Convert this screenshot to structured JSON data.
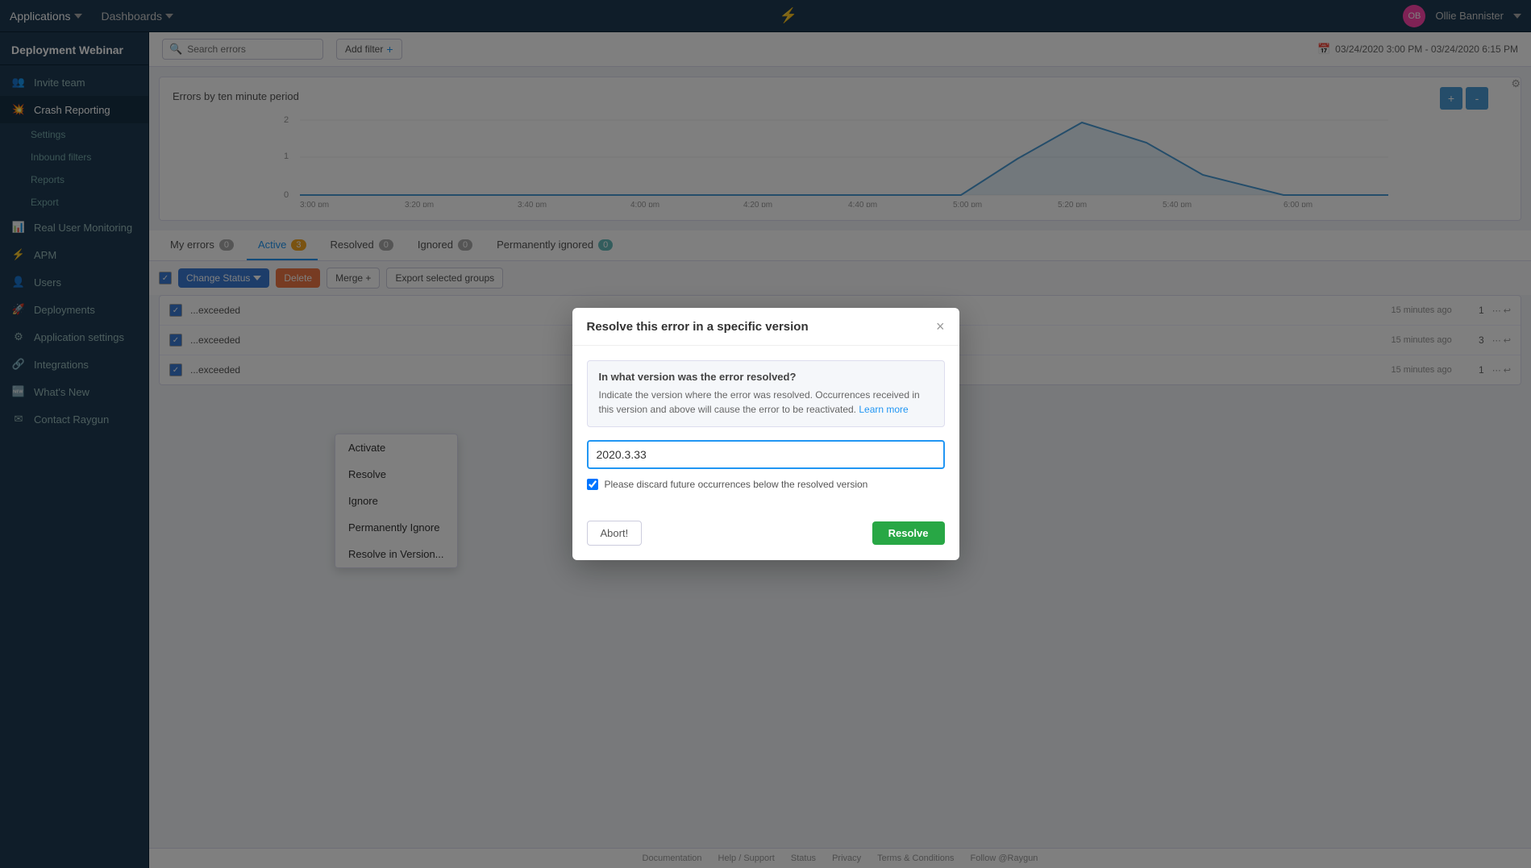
{
  "topnav": {
    "apps_label": "Applications",
    "dashboards_label": "Dashboards",
    "alert_icon": "bell",
    "user_name": "Ollie Bannister",
    "user_initials": "OB"
  },
  "sidebar": {
    "project_name": "Deployment Webinar",
    "invite_team": "Invite team",
    "sections": [
      {
        "label": "Crash Reporting",
        "icon": "crash",
        "active": true,
        "children": [
          {
            "label": "Settings"
          },
          {
            "label": "Inbound filters"
          },
          {
            "label": "Reports"
          },
          {
            "label": "Export"
          }
        ]
      },
      {
        "label": "Real User Monitoring",
        "icon": "rum"
      },
      {
        "label": "APM",
        "icon": "apm"
      },
      {
        "label": "Users",
        "icon": "users"
      },
      {
        "label": "Deployments",
        "icon": "deployments"
      },
      {
        "label": "Application settings",
        "icon": "appsettings"
      },
      {
        "label": "Integrations",
        "icon": "integrations"
      },
      {
        "label": "What's New",
        "icon": "whatsnew"
      },
      {
        "label": "Contact Raygun",
        "icon": "contact"
      }
    ]
  },
  "subheader": {
    "search_placeholder": "Search errors",
    "add_filter_label": "Add filter",
    "date_range": "03/24/2020 3:00 PM - 03/24/2020 6:15 PM"
  },
  "chart": {
    "title": "Errors by ten minute period",
    "y_labels": [
      "2",
      "1",
      "0"
    ],
    "x_labels": [
      "3:00 pm",
      "3:20 pm",
      "3:40 pm",
      "4:00 pm",
      "4:20 pm",
      "4:40 pm",
      "5:00 pm",
      "5:20 pm",
      "5:40 pm",
      "6:00 pm"
    ]
  },
  "tabs": [
    {
      "label": "My errors",
      "badge": "0",
      "badge_color": "gray",
      "active": false
    },
    {
      "label": "Active",
      "badge": "3",
      "badge_color": "orange",
      "active": true
    },
    {
      "label": "Resolved",
      "badge": "0",
      "badge_color": "gray",
      "active": false
    },
    {
      "label": "Ignored",
      "badge": "0",
      "badge_color": "gray",
      "active": false
    },
    {
      "label": "Permanently ignored",
      "badge": "0",
      "badge_color": "teal",
      "active": false
    }
  ],
  "toolbar": {
    "change_status_label": "Change Status",
    "delete_label": "Delete",
    "merge_label": "Merge +",
    "export_label": "Export selected groups"
  },
  "dropdown": {
    "items": [
      {
        "label": "Activate"
      },
      {
        "label": "Resolve"
      },
      {
        "label": "Ignore"
      },
      {
        "label": "Permanently Ignore"
      },
      {
        "label": "Resolve in Version..."
      }
    ]
  },
  "errors": [
    {
      "msg": "...exceeded",
      "time": "15 minutes ago",
      "count": "1"
    },
    {
      "msg": "...exceeded",
      "time": "15 minutes ago",
      "count": "3"
    },
    {
      "msg": "...exceeded",
      "time": "15 minutes ago",
      "count": "1"
    }
  ],
  "footer": {
    "links": [
      "Documentation",
      "Help / Support",
      "Status",
      "Privacy",
      "Terms & Conditions",
      "Follow @Raygun"
    ]
  },
  "modal": {
    "title": "Resolve this error in a specific version",
    "close_icon": "×",
    "info_title": "In what version was the error resolved?",
    "info_text": "Indicate the version where the error was resolved. Occurrences received in this version and above will cause the error to be reactivated.",
    "learn_more_label": "Learn more",
    "input_value": "2020.3.33",
    "checkbox_label": "Please discard future occurrences below the resolved version",
    "checkbox_checked": true,
    "abort_label": "Abort!",
    "resolve_label": "Resolve"
  }
}
